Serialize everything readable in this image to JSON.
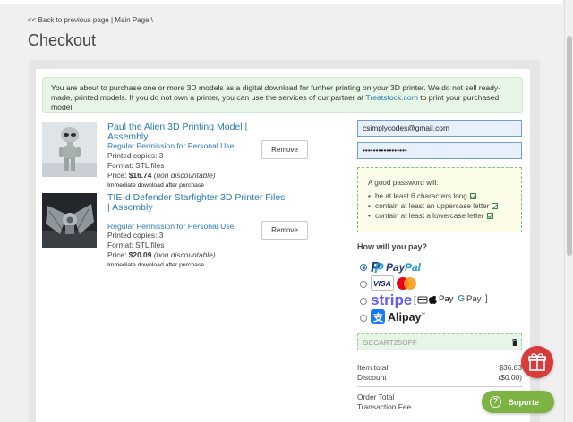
{
  "breadcrumb": {
    "back": "<< Back to previous page",
    "sep1": "|",
    "main": "Main Page",
    "sep2": "\\"
  },
  "page_title": "Checkout",
  "notice": {
    "text": "You are about to purchase one or more 3D models as a digital download for further printing on your 3D printer. We do not sell ready-made, printed models. If you do not own a printer, you can use the services of our partner at ",
    "link": "Treatstock.com",
    "tail": " to print your purchased model."
  },
  "items": [
    {
      "title": "Paul the Alien 3D Printing Model | Assembly",
      "permission": "Regular Permission for Personal Use",
      "copies": "Printed copies: 3",
      "format": "Format: STL files",
      "price_label": "Price: ",
      "price": "$16.74",
      "price_note": "(non discountable)",
      "note": "Immediate download after purchase",
      "remove": "Remove"
    },
    {
      "title": "TIE-d Defender Starfighter 3D Printer Files | Assembly",
      "permission": "Regular Permission for Personal Use",
      "copies": "Printed copies: 3",
      "format": "Format: STL files",
      "price_label": "Price: ",
      "price": "$20.09",
      "price_note": "(non discountable)",
      "note": "Immediate download after purchase",
      "remove": "Remove"
    }
  ],
  "form": {
    "email": "csimplycodes@gmail.com",
    "password": "•••••••••••••••••"
  },
  "password_rules": {
    "heading": "A good password will:",
    "rules": [
      "be at least 6 characters long",
      "contain at least an uppercase letter",
      "contain at least a lowercase letter"
    ]
  },
  "payment": {
    "question": "How will you pay?",
    "methods": [
      "PayPal",
      "Visa / Mastercard",
      "stripe",
      "Alipay"
    ],
    "selected": "PayPal",
    "stripe_pay": "Pay",
    "stripe_gpay": "Pay"
  },
  "coupon": {
    "value": "GECART25OFF"
  },
  "summary": [
    {
      "label": "Item total",
      "value": "$36.83"
    },
    {
      "label": "Discount",
      "value": "($0.00)"
    },
    {
      "label": "Order Total",
      "value": ""
    },
    {
      "label": "Transaction Fee",
      "value": ""
    }
  ],
  "support": {
    "label": "Soporte"
  },
  "colors": {
    "accent": "#2a7ab8",
    "notice_bg": "#e6f5e6",
    "support_green": "#7cb342",
    "gift_red": "#d93a3a"
  }
}
